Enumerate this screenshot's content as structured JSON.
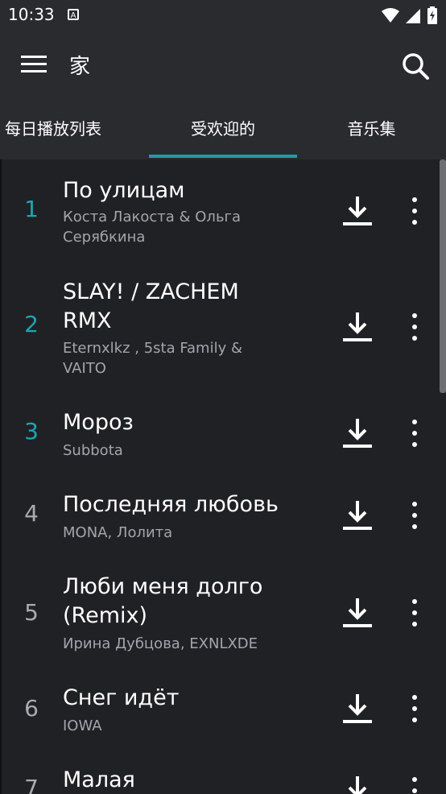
{
  "status_bar": {
    "time": "10:33",
    "notification_letter": "A"
  },
  "app_bar": {
    "title": "家"
  },
  "tabs": [
    {
      "label": "每日播放列表"
    },
    {
      "label": "受欢迎的",
      "selected": true
    },
    {
      "label": "音乐集"
    }
  ],
  "colors": {
    "accent": "#1ea4b5",
    "background": "#202124",
    "bar": "#2a2b2f"
  },
  "songs": [
    {
      "rank": "1",
      "title_lines": [
        "По улицам"
      ],
      "artist_lines": [
        "Коста Лакоста & Ольга",
        "Серябкина"
      ]
    },
    {
      "rank": "2",
      "title_lines": [
        "SLAY! / ZACHEM",
        "RMX"
      ],
      "artist_lines": [
        "Eternxlkz , 5sta Family &",
        "VAITO"
      ]
    },
    {
      "rank": "3",
      "title_lines": [
        "Мороз"
      ],
      "artist_lines": [
        "Subbota"
      ]
    },
    {
      "rank": "4",
      "title_lines": [
        "Последняя любовь"
      ],
      "artist_lines": [
        "MONA, Лолита"
      ]
    },
    {
      "rank": "5",
      "title_lines": [
        "Люби меня долго",
        "(Remix)"
      ],
      "artist_lines": [
        "Ирина Дубцова, EXNLXDE"
      ]
    },
    {
      "rank": "6",
      "title_lines": [
        "Снег идёт"
      ],
      "artist_lines": [
        "IOWA"
      ]
    },
    {
      "rank": "7",
      "title_lines": [
        "Малая"
      ],
      "artist_lines": []
    }
  ]
}
